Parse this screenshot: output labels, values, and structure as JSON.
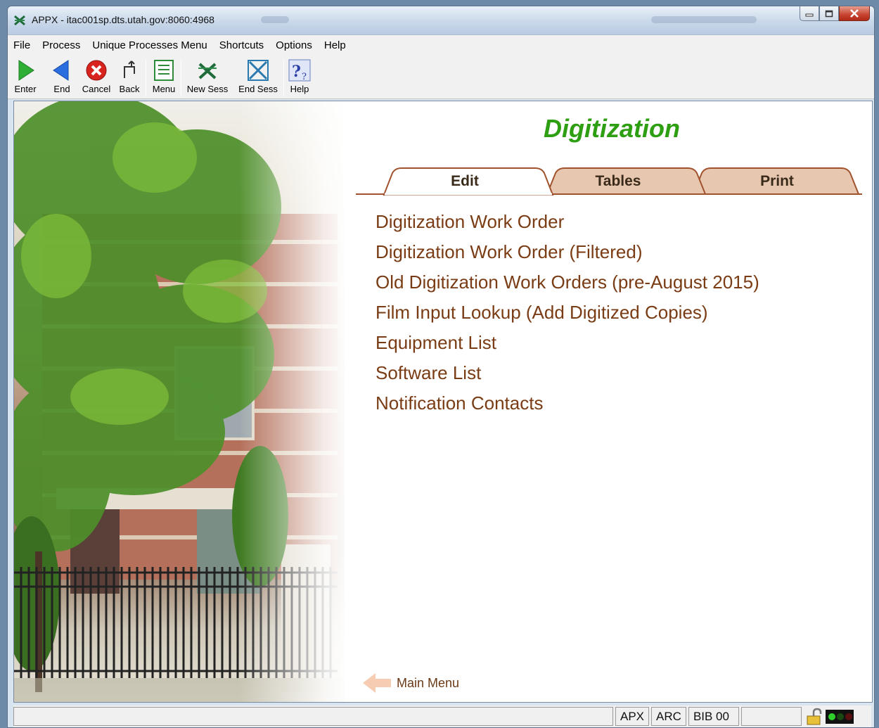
{
  "window": {
    "title": "APPX - itac001sp.dts.utah.gov:8060:4968"
  },
  "menubar": {
    "items": [
      "File",
      "Process",
      "Unique Processes Menu",
      "Shortcuts",
      "Options",
      "Help"
    ]
  },
  "toolbar": {
    "buttons": [
      {
        "label": "Enter",
        "icon": "enter-arrow-icon"
      },
      {
        "label": "End",
        "icon": "end-arrow-icon"
      },
      {
        "label": "Cancel",
        "icon": "cancel-x-icon"
      },
      {
        "label": "Back",
        "icon": "back-arrow-icon"
      },
      {
        "label": "Menu",
        "icon": "menu-list-icon"
      },
      {
        "label": "New Sess",
        "icon": "new-session-icon"
      },
      {
        "label": "End Sess",
        "icon": "end-session-icon"
      },
      {
        "label": "Help",
        "icon": "help-icon"
      }
    ]
  },
  "main": {
    "heading": "Digitization",
    "tabs": [
      {
        "label": "Edit",
        "active": true
      },
      {
        "label": "Tables",
        "active": false
      },
      {
        "label": "Print",
        "active": false
      }
    ],
    "items": [
      "Digitization Work Order",
      "Digitization Work Order (Filtered)",
      "Old Digitization Work Orders (pre-August 2015)",
      "Film Input Lookup (Add Digitized Copies)",
      "Equipment List",
      "Software List",
      "Notification Contacts"
    ],
    "back_link": "Main Menu"
  },
  "statusbar": {
    "cells": [
      "APX",
      "ARC",
      "BIB 00"
    ]
  },
  "colors": {
    "heading": "#2e9e12",
    "menu_text": "#7a3c14",
    "tab_fill": "#e8c7b0",
    "tab_border": "#a0522d"
  }
}
